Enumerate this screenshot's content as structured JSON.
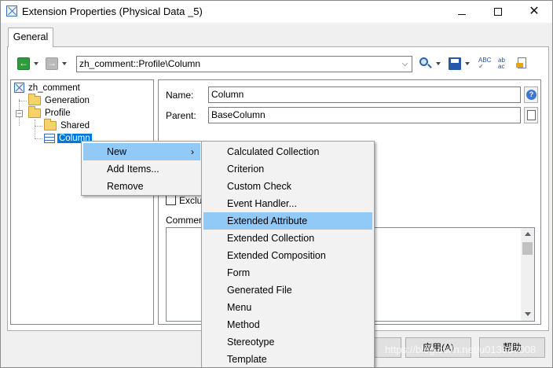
{
  "window": {
    "title": "Extension Properties (Physical Data _5)",
    "controls": {
      "minimize": "",
      "maximize": "",
      "close": "✕"
    }
  },
  "tabs": [
    {
      "label": "General",
      "selected": true
    }
  ],
  "toolbar": {
    "back_glyph": "←",
    "forward_glyph": "→",
    "path_value": "zh_comment::Profile\\Column",
    "combo_arrow": "⌵",
    "spell_text": "ABC ✓",
    "replace_text": "ab ac"
  },
  "tree": {
    "nodes": [
      {
        "label": "zh_comment",
        "icon": "extension-icon"
      },
      {
        "label": "Generation",
        "icon": "folder-icon"
      },
      {
        "label": "Profile",
        "icon": "folder-icon",
        "expanded": true
      },
      {
        "label": "Shared",
        "icon": "folder-icon"
      },
      {
        "label": "Column",
        "icon": "class-icon",
        "selected": true
      }
    ],
    "expander_glyph": "−"
  },
  "props": {
    "name_label": "Name:",
    "name_value": "Column",
    "parent_label": "Parent:",
    "parent_value": "BaseColumn",
    "exclude_label": "Exclu",
    "comment_label": "Comment"
  },
  "context_menu": {
    "items": [
      {
        "label": "New",
        "has_submenu": true,
        "highlighted": true
      },
      {
        "label": "Add Items...",
        "has_submenu": false
      },
      {
        "label": "Remove",
        "has_submenu": false
      }
    ],
    "submenu_arrow": "›"
  },
  "submenu": {
    "items": [
      {
        "label": "Calculated Collection"
      },
      {
        "label": "Criterion"
      },
      {
        "label": "Custom Check"
      },
      {
        "label": "Event Handler..."
      },
      {
        "label": "Extended Attribute",
        "highlighted": true
      },
      {
        "label": "Extended Collection"
      },
      {
        "label": "Extended Composition"
      },
      {
        "label": "Form"
      },
      {
        "label": "Generated File"
      },
      {
        "label": "Menu"
      },
      {
        "label": "Method"
      },
      {
        "label": "Stereotype"
      },
      {
        "label": "Template"
      }
    ]
  },
  "buttons": {
    "apply": "应用(A)",
    "help": "帮助"
  },
  "watermark": "https://blog.csdn.net/u013887008",
  "colors": {
    "selection": "#0078d7",
    "menu_highlight": "#91c9f7",
    "menu_bg": "#f2f2f2"
  }
}
